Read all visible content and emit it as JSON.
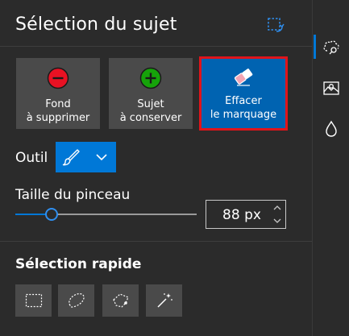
{
  "header": {
    "title": "Sélection du sujet"
  },
  "actions": {
    "remove": {
      "line1": "Fond",
      "line2": "à supprimer"
    },
    "keep": {
      "line1": "Sujet",
      "line2": "à conserver"
    },
    "erase": {
      "line1": "Effacer",
      "line2": "le marquage"
    }
  },
  "tool": {
    "label": "Outil"
  },
  "brush": {
    "label": "Taille du pinceau",
    "value": "88 px",
    "slider_fraction": 0.2
  },
  "quick": {
    "title": "Sélection rapide"
  },
  "colors": {
    "accent": "#0078d7",
    "highlight_border": "#e0141b",
    "remove_red": "#e81123",
    "keep_green": "#16a30a"
  }
}
